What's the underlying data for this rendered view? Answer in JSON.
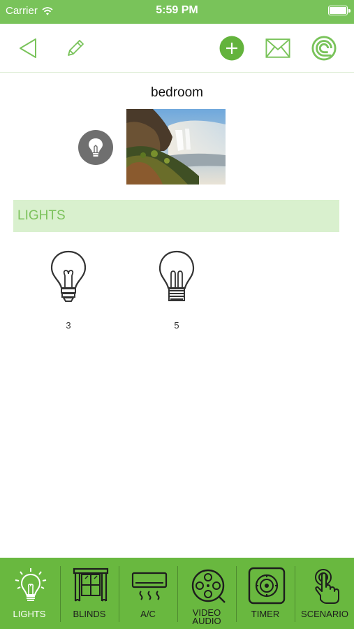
{
  "status_bar": {
    "carrier": "Carrier",
    "time": "5:59 PM"
  },
  "toolbar": {
    "back_icon": "back-triangle-icon",
    "edit_icon": "pencil-icon",
    "add_icon": "plus-circle-icon",
    "mail_icon": "envelope-icon",
    "logo_icon": "spiral-logo-icon"
  },
  "room": {
    "title": "bedroom",
    "photo": "waterfall-photo",
    "badge_icon": "lightbulb-icon"
  },
  "section": {
    "label": "LIGHTS"
  },
  "devices": [
    {
      "label": "3",
      "icon": "lightbulb-filament-icon"
    },
    {
      "label": "5",
      "icon": "lightbulb-cfl-icon"
    }
  ],
  "tabs": [
    {
      "label": "LIGHTS",
      "icon": "light-icon",
      "active": true
    },
    {
      "label": "BLINDS",
      "icon": "blinds-icon",
      "active": false
    },
    {
      "label": "A/C",
      "icon": "ac-icon",
      "active": false
    },
    {
      "label_line1": "VIDEO",
      "label_line2": "AUDIO",
      "icon": "video-audio-icon",
      "active": false
    },
    {
      "label": "TIMER",
      "icon": "timer-icon",
      "active": false
    },
    {
      "label": "SCENARIO",
      "icon": "scenario-hand-icon",
      "active": false
    }
  ],
  "colors": {
    "brand_green": "#79c35a",
    "tab_green": "#69b83f",
    "section_band": "#d9f0ce",
    "section_text": "#7cc25c"
  }
}
